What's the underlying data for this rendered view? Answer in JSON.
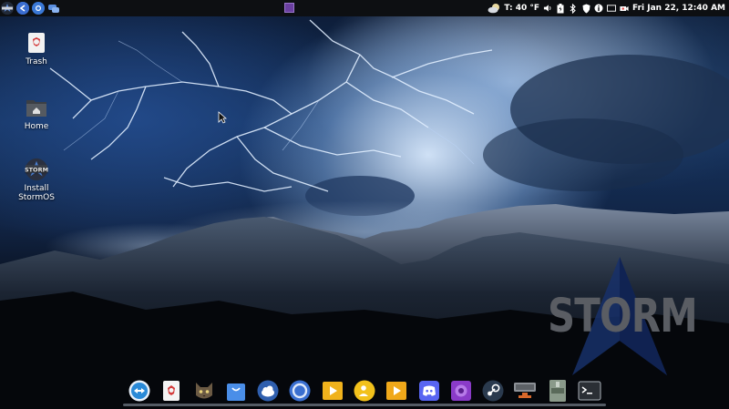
{
  "top_panel": {
    "launchers": [
      {
        "icon": "storm-menu-icon"
      },
      {
        "icon": "back-arrow-icon"
      },
      {
        "icon": "browser-icon"
      },
      {
        "icon": "chat-bubbles-icon"
      }
    ],
    "workspace": {
      "icon": "workspace-square-icon",
      "color": "#6a3fa0"
    },
    "weather": {
      "icon": "cloudy-moon-icon",
      "text": "T: 40 °F"
    },
    "tray_icons": [
      "volume-icon",
      "battery-icon",
      "bluetooth-icon",
      "shield-icon",
      "info-icon",
      "display-icon",
      "camera-icon"
    ],
    "clock": "Fri Jan 22, 12:40 AM"
  },
  "desktop_icons": [
    {
      "label": "Trash",
      "icon": "trash-icon"
    },
    {
      "label": "Home",
      "icon": "home-folder-icon"
    },
    {
      "label": "Install\nStormOS",
      "label_lines": [
        "Install",
        "StormOS"
      ],
      "icon": "storm-install-icon",
      "badge": "STORM"
    }
  ],
  "watermark": {
    "text": "STORM"
  },
  "dock": {
    "items": [
      {
        "icon": "teamviewer-icon"
      },
      {
        "icon": "trash-icon"
      },
      {
        "icon": "cat-app-icon"
      },
      {
        "icon": "store-bag-icon"
      },
      {
        "icon": "cloud-app-icon"
      },
      {
        "icon": "ring-app-icon"
      },
      {
        "icon": "media-player-icon"
      },
      {
        "icon": "user-app-icon"
      },
      {
        "icon": "media-player-alt-icon"
      },
      {
        "icon": "discord-icon"
      },
      {
        "icon": "purple-app-icon"
      },
      {
        "icon": "steam-icon"
      },
      {
        "icon": "network-manager-icon"
      },
      {
        "icon": "archive-icon"
      },
      {
        "icon": "terminal-icon"
      }
    ]
  },
  "colors": {
    "panel": "#0d0f12",
    "accent": "#6a3fa0",
    "watermark": "#5a5d63"
  }
}
